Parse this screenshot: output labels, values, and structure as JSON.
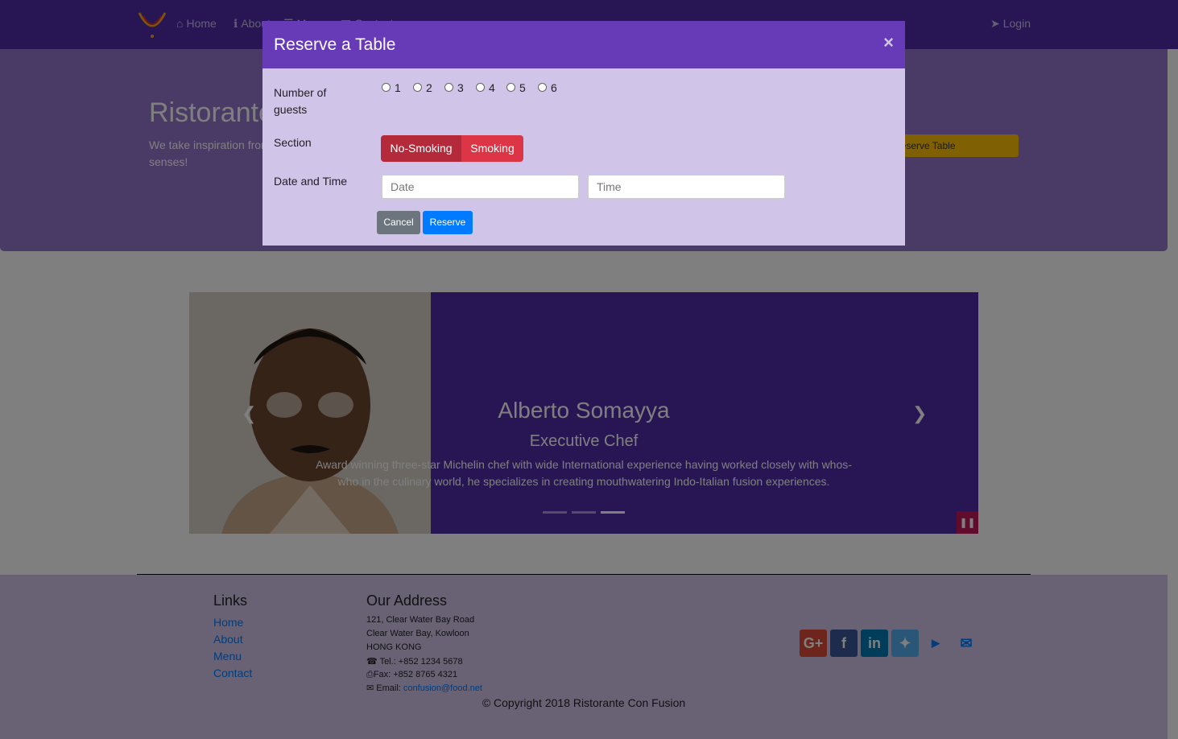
{
  "navbar": {
    "items": [
      {
        "label": "Home",
        "icon": "home-icon"
      },
      {
        "label": "About",
        "icon": "info-icon"
      },
      {
        "label": "Menu",
        "icon": "list-icon"
      },
      {
        "label": "Contact",
        "icon": "address-card-icon"
      }
    ],
    "login_label": "Login"
  },
  "jumbotron": {
    "title": "Ristorante Con Fusion",
    "text": "We take inspiration from the World's best cuisines, and create a unique fusion experience. Our lipsmacking creations will tickle your culinary senses!",
    "reserve_label": "Reserve Table"
  },
  "modal": {
    "title": "Reserve a Table",
    "close": "×",
    "guests_label": "Number of guests",
    "guest_options": [
      "1",
      "2",
      "3",
      "4",
      "5",
      "6"
    ],
    "section_label": "Section",
    "section_options": [
      "No-Smoking",
      "Smoking"
    ],
    "datetime_label": "Date and Time",
    "date_placeholder": "Date",
    "time_placeholder": "Time",
    "cancel_label": "Cancel",
    "reserve_label": "Reserve"
  },
  "carousel": {
    "name": "Alberto Somayya",
    "role": "Executive Chef",
    "description": "Award winning three-star Michelin chef with wide International experience having worked closely with whos-who in the culinary world, he specializes in creating mouthwatering Indo-Italian fusion experiences.",
    "active_index": 2,
    "slide_count": 3
  },
  "footer": {
    "links_heading": "Links",
    "links": [
      "Home",
      "About",
      "Menu",
      "Contact"
    ],
    "address_heading": "Our Address",
    "address_lines": [
      "121, Clear Water Bay Road",
      "Clear Water Bay, Kowloon",
      "HONG KONG"
    ],
    "tel": "Tel.: +852 1234 5678",
    "fax": "Fax: +852 8765 4321",
    "email_label": "Email:",
    "email": "confusion@food.net",
    "copyright": "© Copyright 2018 Ristorante Con Fusion"
  },
  "colors": {
    "primary_dark": "#512da8",
    "primary": "#673ab7",
    "primary_light": "#d1c4e9",
    "jumbotron": "#9575cd",
    "danger": "#dc3545",
    "info": "#007bff",
    "warning": "#ffc107"
  }
}
